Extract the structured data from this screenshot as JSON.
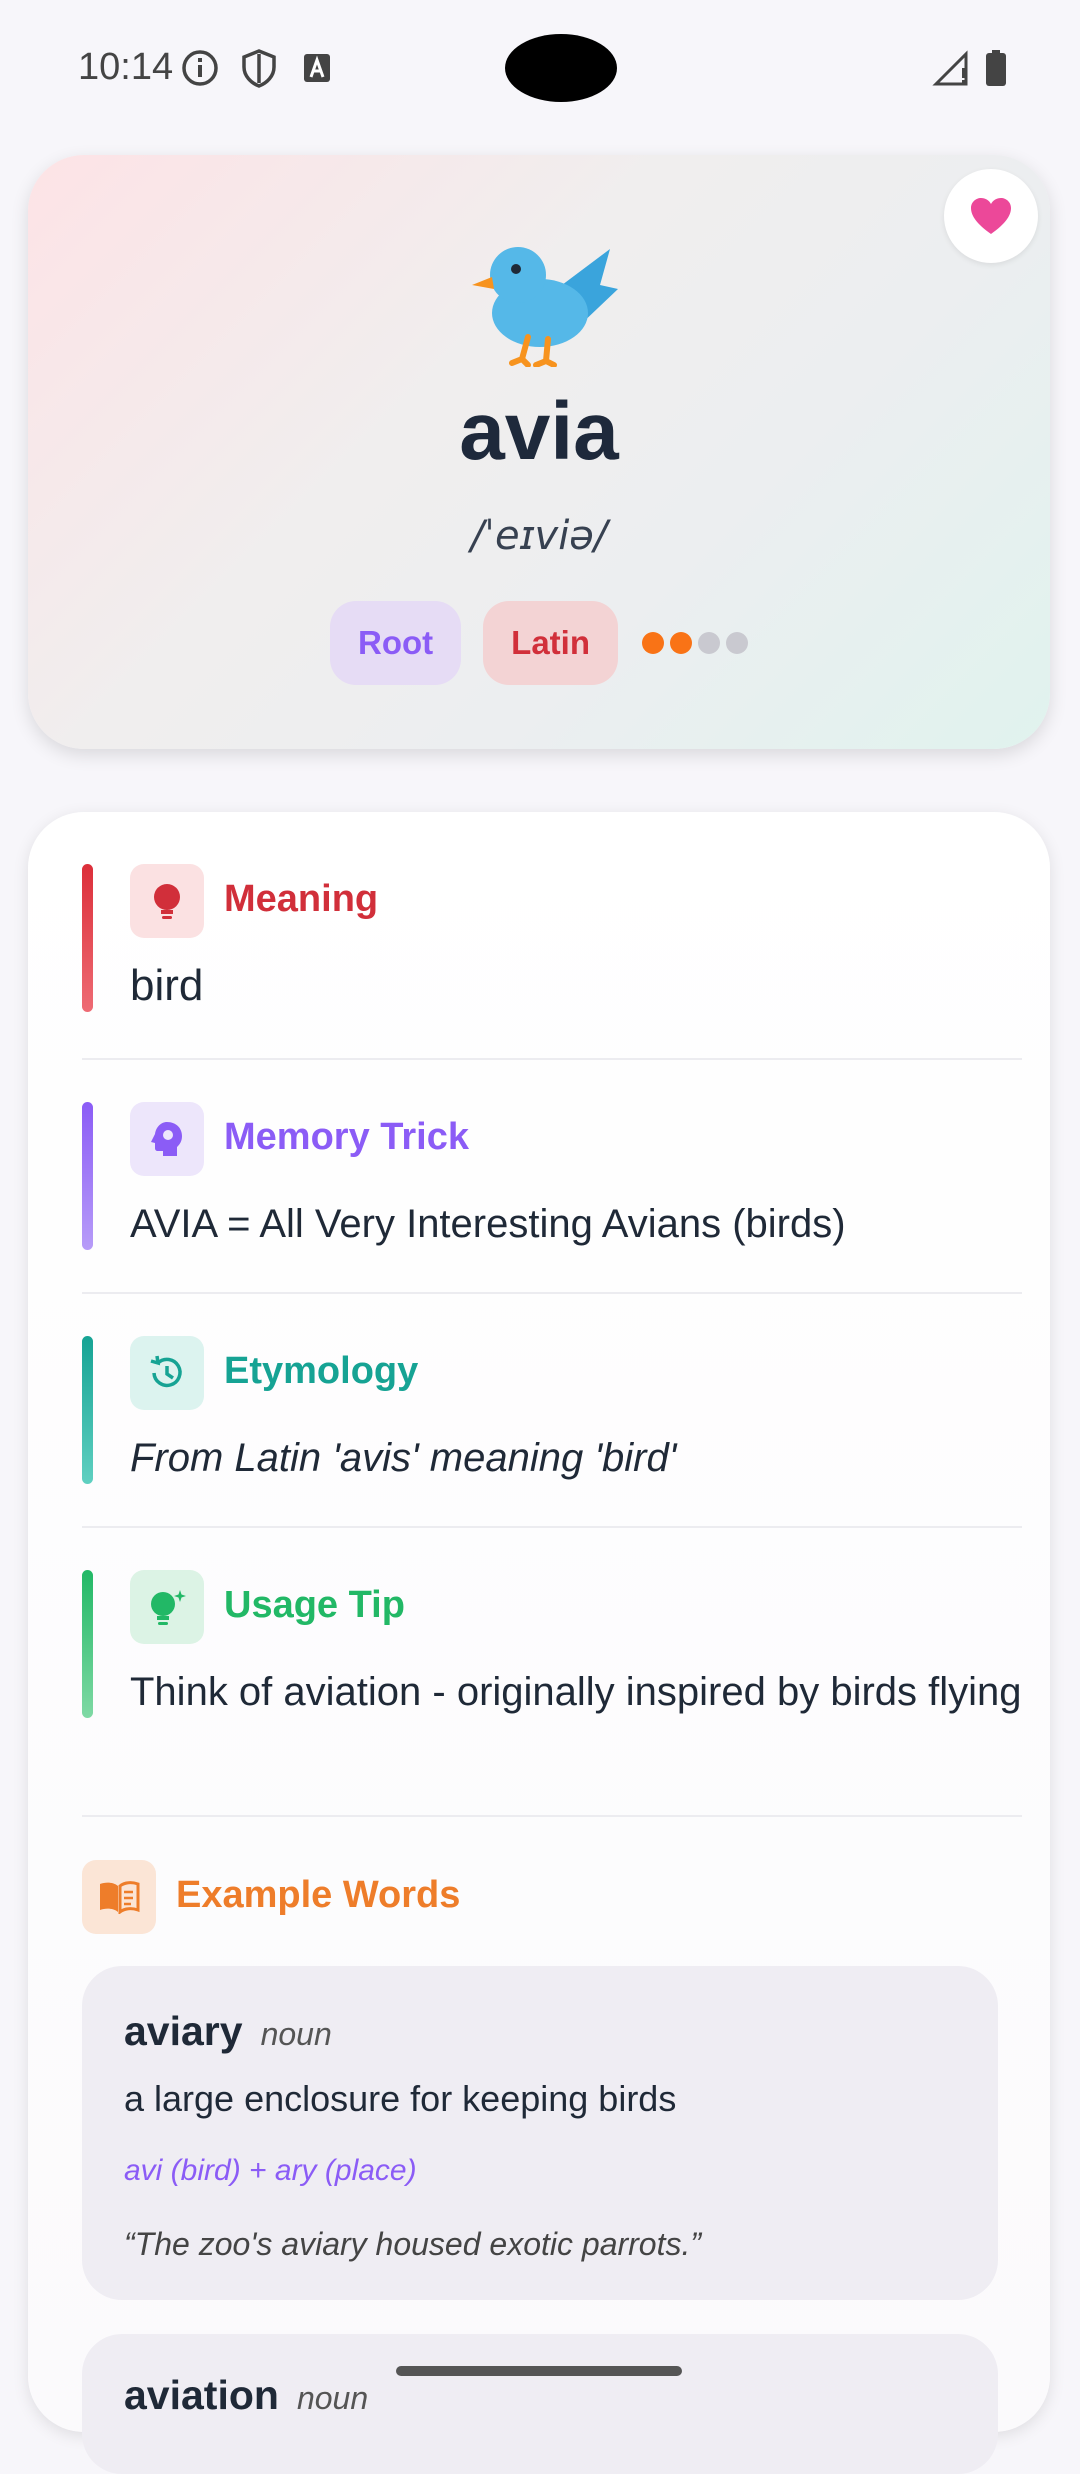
{
  "status_bar": {
    "time": "10:14"
  },
  "hero": {
    "emoji_name": "bird",
    "word": "avia",
    "phonetic": "/ˈeɪviə/",
    "tags": [
      "Root",
      "Latin"
    ],
    "difficulty_filled": 2,
    "difficulty_total": 4
  },
  "sections": {
    "meaning": {
      "title": "Meaning",
      "body": "bird",
      "color": "#d12f3a"
    },
    "memory": {
      "title": "Memory Trick",
      "body": "AVIA = All Very Interesting Avians (birds)",
      "color": "#8b5cf6"
    },
    "etymology": {
      "title": "Etymology",
      "body": "From Latin 'avis' meaning 'bird'",
      "color": "#16a394"
    },
    "usage": {
      "title": "Usage Tip",
      "body": "Think of aviation - originally inspired by birds flying",
      "color": "#22b866"
    }
  },
  "examples": {
    "title": "Example Words",
    "color": "#ee7d2a",
    "items": [
      {
        "word": "aviary",
        "pos": "noun",
        "definition": "a large enclosure for keeping birds",
        "morphology": "avi (bird) + ary (place)",
        "sentence": "“The zoo's aviary housed exotic parrots.”"
      },
      {
        "word": "aviation",
        "pos": "noun"
      }
    ]
  },
  "colors": {
    "accent_orange": "#f97316",
    "heart_pink": "#ec4899"
  }
}
